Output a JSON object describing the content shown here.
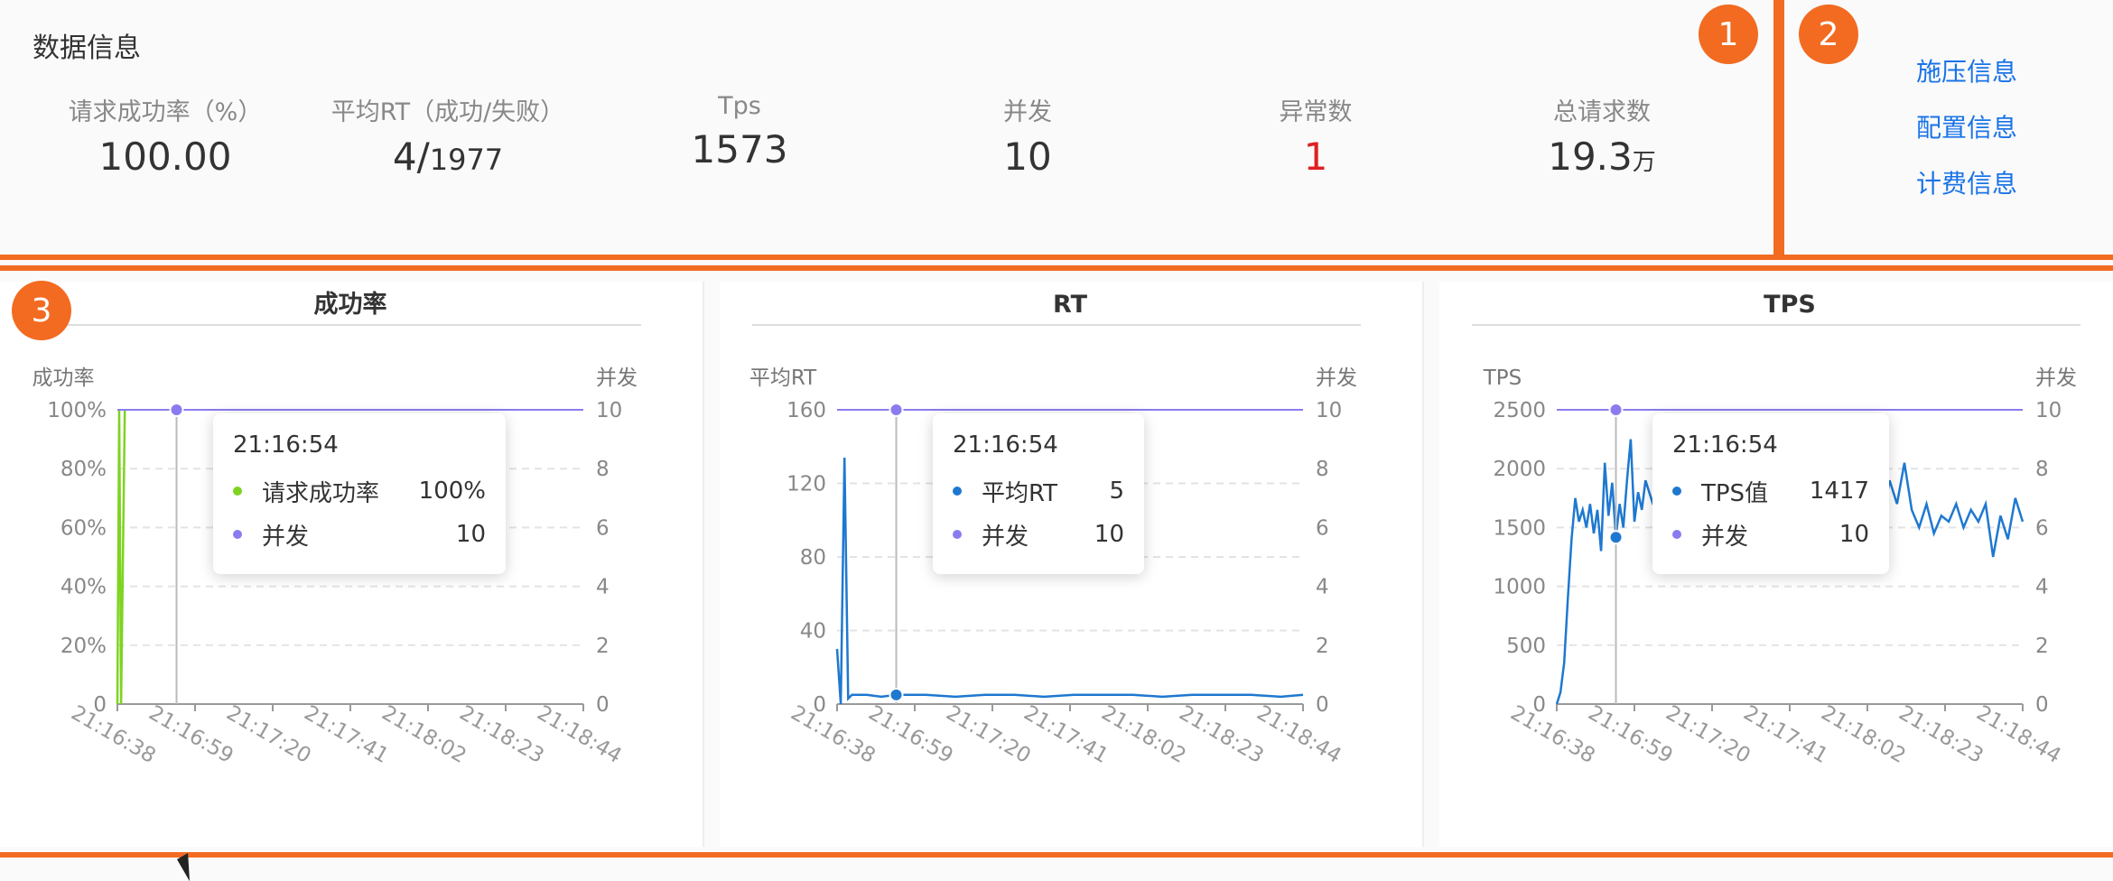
{
  "badges": [
    "1",
    "2",
    "3"
  ],
  "data_info": {
    "title": "数据信息",
    "metrics": [
      {
        "label": "请求成功率（%）",
        "value": "100.00"
      },
      {
        "label": "平均RT（成功/失败）",
        "value": "4/",
        "sub": "1977"
      },
      {
        "label": "Tps",
        "value": "1573"
      },
      {
        "label": "并发",
        "value": "10"
      },
      {
        "label": "异常数",
        "value": "1"
      },
      {
        "label": "总请求数",
        "value": "19.3",
        "unit": "万"
      }
    ]
  },
  "side_links": [
    "施压信息",
    "配置信息",
    "计费信息"
  ],
  "colors": {
    "accent": "#f26b21",
    "link": "#1a73e8",
    "alert": "#e02020",
    "concurrency": "#8a7cf0",
    "success": "#7ed321",
    "rt": "#1e78d0"
  },
  "tooltips": [
    {
      "time": "21:16:54",
      "rows": [
        {
          "name": "请求成功率",
          "value": "100%",
          "color": "#7ed321"
        },
        {
          "name": "并发",
          "value": "10",
          "color": "#8a7cf0"
        }
      ]
    },
    {
      "time": "21:16:54",
      "rows": [
        {
          "name": "平均RT",
          "value": "5",
          "color": "#1e78d0"
        },
        {
          "name": "并发",
          "value": "10",
          "color": "#8a7cf0"
        }
      ]
    },
    {
      "time": "21:16:54",
      "rows": [
        {
          "name": "TPS值",
          "value": "1417",
          "color": "#1e78d0"
        },
        {
          "name": "并发",
          "value": "10",
          "color": "#8a7cf0"
        }
      ]
    }
  ],
  "chart_data": [
    {
      "type": "line",
      "title": "成功率",
      "ylabel": "成功率",
      "y2label": "并发",
      "yticks": [
        "0",
        "20%",
        "40%",
        "60%",
        "80%",
        "100%"
      ],
      "y2ticks": [
        "0",
        "2",
        "4",
        "6",
        "8",
        "10"
      ],
      "ylim": [
        0,
        100
      ],
      "y2lim": [
        0,
        10
      ],
      "xticks": [
        "21:16:38",
        "21:16:59",
        "21:17:20",
        "21:17:41",
        "21:18:02",
        "21:18:23",
        "21:18:44"
      ],
      "xlim": [
        0,
        126
      ],
      "marker_x": 16,
      "series": [
        {
          "name": "请求成功率",
          "axis": "left",
          "color": "#7ed321",
          "x": [
            0,
            0.5,
            1,
            2
          ],
          "values": [
            0,
            100,
            0,
            100
          ]
        },
        {
          "name": "并发",
          "axis": "right",
          "color": "#8a7cf0",
          "x": [
            0,
            126
          ],
          "values": [
            10,
            10
          ]
        }
      ]
    },
    {
      "type": "line",
      "title": "RT",
      "ylabel": "平均RT",
      "y2label": "并发",
      "yticks": [
        "0",
        "40",
        "80",
        "120",
        "160"
      ],
      "y2ticks": [
        "0",
        "2",
        "4",
        "6",
        "8",
        "10"
      ],
      "ylim": [
        0,
        160
      ],
      "y2lim": [
        0,
        10
      ],
      "xticks": [
        "21:16:38",
        "21:16:59",
        "21:17:20",
        "21:17:41",
        "21:18:02",
        "21:18:23",
        "21:18:44"
      ],
      "xlim": [
        0,
        126
      ],
      "marker_x": 16,
      "series": [
        {
          "name": "平均RT",
          "axis": "left",
          "color": "#1e78d0",
          "x": [
            0,
            1,
            2,
            3,
            4,
            8,
            12,
            16,
            24,
            32,
            40,
            48,
            56,
            64,
            72,
            80,
            88,
            96,
            104,
            112,
            120,
            126
          ],
          "values": [
            30,
            0,
            134,
            3,
            5,
            5,
            4,
            5,
            5,
            4,
            5,
            5,
            4,
            5,
            5,
            5,
            4,
            5,
            5,
            5,
            4,
            5
          ]
        },
        {
          "name": "并发",
          "axis": "right",
          "color": "#8a7cf0",
          "x": [
            0,
            126
          ],
          "values": [
            10,
            10
          ]
        }
      ]
    },
    {
      "type": "line",
      "title": "TPS",
      "ylabel": "TPS",
      "y2label": "并发",
      "yticks": [
        "0",
        "500",
        "1000",
        "1500",
        "2000",
        "2500"
      ],
      "y2ticks": [
        "0",
        "2",
        "4",
        "6",
        "8",
        "10"
      ],
      "ylim": [
        0,
        2500
      ],
      "y2lim": [
        0,
        10
      ],
      "xticks": [
        "21:16:38",
        "21:16:59",
        "21:17:20",
        "21:17:41",
        "21:18:02",
        "21:18:23",
        "21:18:44"
      ],
      "xlim": [
        0,
        126
      ],
      "marker_x": 16,
      "series": [
        {
          "name": "TPS值",
          "axis": "left",
          "color": "#1e78d0",
          "x": [
            0,
            1,
            2,
            3,
            4,
            5,
            6,
            7,
            8,
            9,
            10,
            11,
            12,
            13,
            14,
            15,
            16,
            17,
            18,
            19,
            20,
            21,
            22,
            23,
            24,
            26,
            28,
            30,
            32,
            34,
            36,
            38,
            40,
            42,
            44,
            46,
            48,
            50,
            52,
            54,
            56,
            58,
            60,
            62,
            64,
            66,
            68,
            70,
            72,
            74,
            76,
            78,
            80,
            82,
            84,
            86,
            88,
            90,
            92,
            94,
            96,
            98,
            100,
            102,
            104,
            106,
            108,
            110,
            112,
            114,
            116,
            118,
            120,
            122,
            124,
            126
          ],
          "values": [
            0,
            100,
            350,
            900,
            1400,
            1750,
            1550,
            1650,
            1500,
            1700,
            1450,
            1650,
            1300,
            2050,
            1600,
            1880,
            1417,
            1700,
            1500,
            1900,
            2250,
            1550,
            1800,
            1650,
            1900,
            1700,
            1600,
            1800,
            1650,
            1750,
            1550,
            1700,
            1850,
            1600,
            1700,
            1650,
            1500,
            1750,
            1650,
            1600,
            1800,
            1700,
            1650,
            1750,
            1600,
            1700,
            1800,
            1650,
            1550,
            1700,
            1600,
            1750,
            1650,
            1500,
            1700,
            1850,
            1550,
            1900,
            1700,
            2050,
            1650,
            1500,
            1700,
            1450,
            1600,
            1550,
            1700,
            1500,
            1650,
            1550,
            1700,
            1250,
            1600,
            1400,
            1750,
            1550
          ]
        },
        {
          "name": "并发",
          "axis": "right",
          "color": "#8a7cf0",
          "x": [
            0,
            126
          ],
          "values": [
            10,
            10
          ]
        }
      ]
    }
  ]
}
